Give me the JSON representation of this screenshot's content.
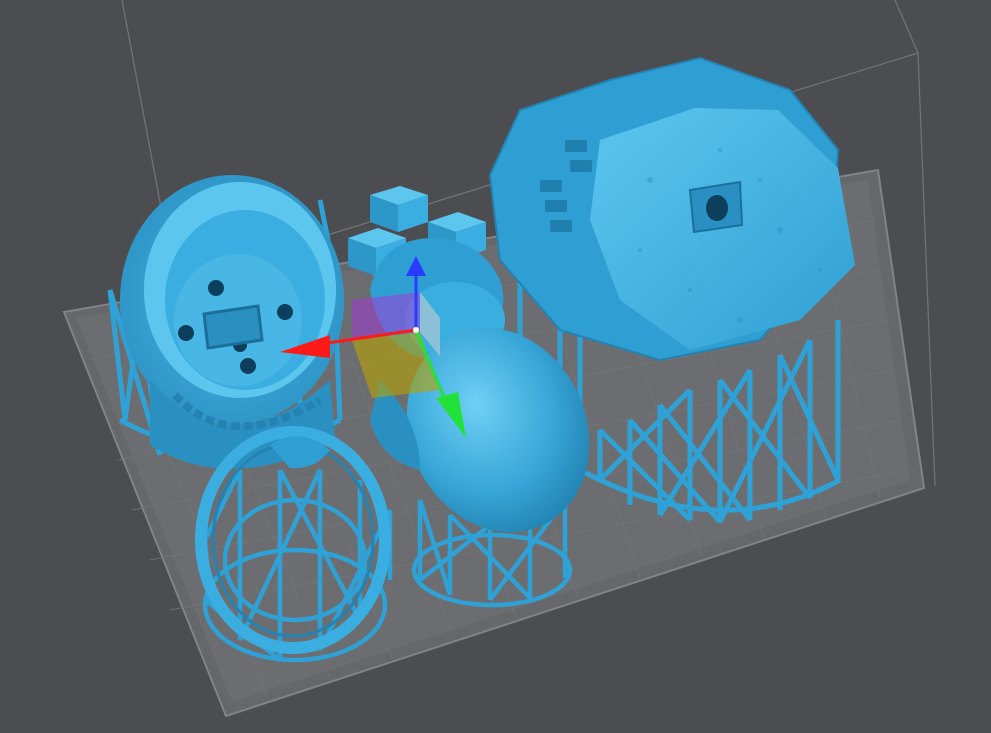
{
  "viewport": {
    "background": "#4c4d50",
    "build_volume_color": "#6f7074",
    "build_plate_color": "#6a6b6e",
    "build_plate_edge_color": "#808185",
    "model_color": "#3aaee0",
    "model_shade_color": "#2b8fbf",
    "model_highlight_color": "#6fd0f5",
    "support_color": "#2ea2d6"
  },
  "gizmo": {
    "x_axis_color": "#ff1a1a",
    "y_axis_color": "#22e23a",
    "z_axis_color": "#2a3cff",
    "xy_plane_color": "#b8a400",
    "xz_plane_color": "#a13bd6",
    "yz_plane_color": "#cfcfcf"
  },
  "models": [
    {
      "icon": "bowl-icon"
    },
    {
      "icon": "ring-icon"
    },
    {
      "icon": "head-icon"
    },
    {
      "icon": "octagon-plate-icon"
    },
    {
      "icon": "cube-icon"
    }
  ]
}
